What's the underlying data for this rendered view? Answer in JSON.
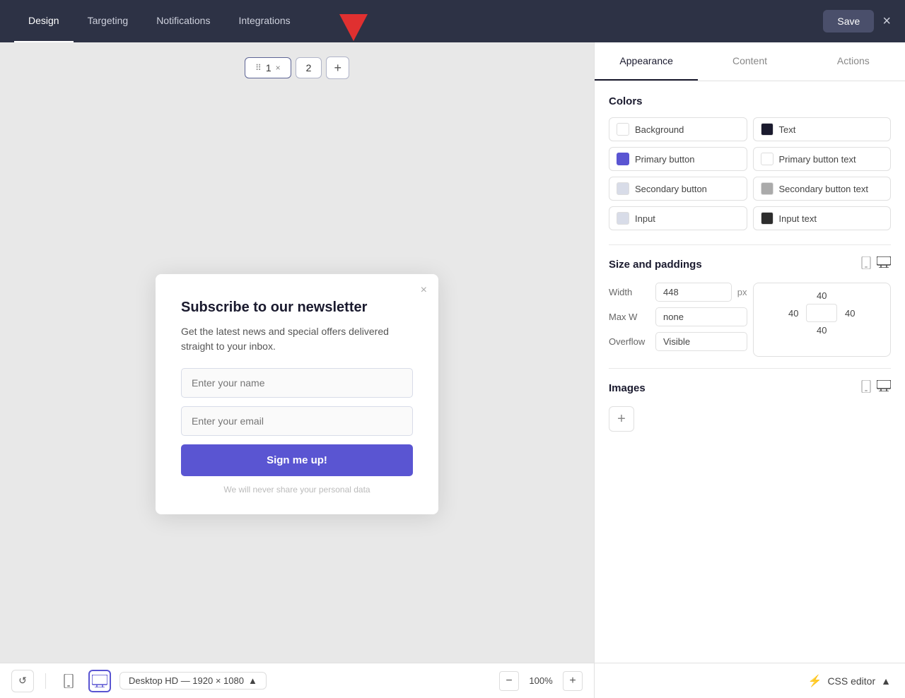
{
  "nav": {
    "tabs": [
      {
        "label": "Design",
        "active": true
      },
      {
        "label": "Targeting",
        "active": false
      },
      {
        "label": "Notifications",
        "active": false
      },
      {
        "label": "Integrations",
        "active": false
      }
    ],
    "save_label": "Save",
    "close_label": "×"
  },
  "steps": {
    "tab1_label": "1",
    "tab2_label": "2",
    "add_label": "+"
  },
  "modal": {
    "close_label": "×",
    "title": "Subscribe to our newsletter",
    "description": "Get the latest news and special offers delivered straight to your inbox.",
    "name_placeholder": "Enter your name",
    "email_placeholder": "Enter your email",
    "button_label": "Sign me up!",
    "disclaimer": "We will never share your personal data"
  },
  "panel": {
    "tabs": [
      {
        "label": "Appearance",
        "active": true
      },
      {
        "label": "Content",
        "active": false
      },
      {
        "label": "Actions",
        "active": false
      }
    ],
    "colors": {
      "title": "Colors",
      "items": [
        {
          "label": "Background",
          "swatch": "white",
          "side": "left"
        },
        {
          "label": "Text",
          "swatch": "black",
          "side": "right"
        },
        {
          "label": "Primary button",
          "swatch": "purple",
          "side": "left"
        },
        {
          "label": "Primary button text",
          "swatch": "white",
          "side": "right"
        },
        {
          "label": "Secondary button",
          "swatch": "light-gray",
          "side": "left"
        },
        {
          "label": "Secondary button text",
          "swatch": "gray",
          "side": "right"
        },
        {
          "label": "Input",
          "swatch": "light-gray",
          "side": "left"
        },
        {
          "label": "Input text",
          "swatch": "dark",
          "side": "right"
        }
      ]
    },
    "size_paddings": {
      "title": "Size and paddings",
      "width_label": "Width",
      "width_value": "448",
      "width_unit": "px",
      "maxw_label": "Max W",
      "maxw_value": "none",
      "overflow_label": "Overflow",
      "overflow_value": "Visible",
      "padding_top": "40",
      "padding_left": "40",
      "padding_right": "40",
      "padding_bottom": "40"
    },
    "images": {
      "title": "Images"
    },
    "css_editor_label": "CSS editor",
    "css_editor_icon": "⚡"
  },
  "bottom_bar": {
    "resolution_label": "Desktop HD — 1920 × 1080",
    "zoom_value": "100%",
    "zoom_in_label": "+",
    "zoom_out_label": "−",
    "refresh_icon": "↺",
    "mobile_icon": "📱",
    "desktop_icon": "🖥"
  }
}
